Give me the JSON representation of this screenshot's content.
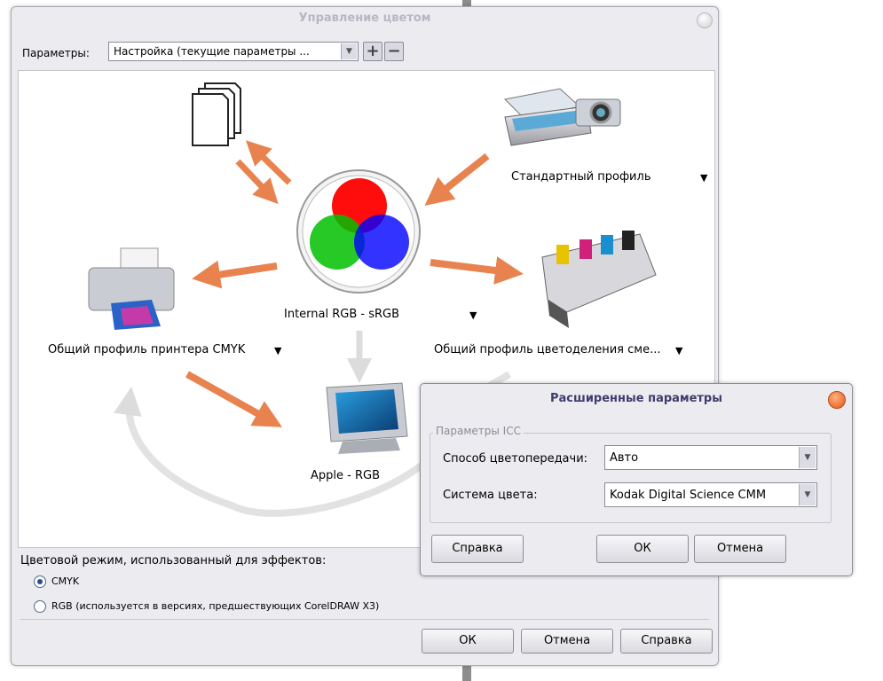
{
  "main_dialog": {
    "title": "Управление цветом",
    "params_label": "Параметры:",
    "preset_value": "Настройка (текущие параметры ...",
    "plus_label": "+",
    "minus_label": "−",
    "nodes": {
      "document_label": "",
      "input_label": "Стандартный профиль",
      "internal_label": "Internal RGB - sRGB",
      "printer_label": "Общий профиль принтера CMYK",
      "separation_label": "Общий профиль цветоделения сме...",
      "monitor_label": "Apple - RGB"
    },
    "dropdown_glyph": "▼",
    "effects_label": "Цветовой режим, использованный для эффектов:",
    "radio_cmyk_label": "CMYK",
    "radio_rgb_label": "RGB (используется в версиях, предшествующих CorelDRAW X3)",
    "radio_selected": "CMYK",
    "ok_label": "ОК",
    "cancel_label": "Отмена",
    "help_label": "Справка"
  },
  "advanced_dialog": {
    "title": "Расширенные параметры",
    "group_title": "Параметры ICC",
    "rendering_label": "Способ цветопередачи:",
    "rendering_value": "Авто",
    "system_label": "Система цвета:",
    "system_value": "Kodak Digital Science CMM",
    "help_label": "Справка",
    "ok_label": "ОК",
    "cancel_label": "Отмена"
  },
  "colors": {
    "arrow": "#e8834f",
    "gray_arrow": "#dcdcdc",
    "close_button": "#e4551c",
    "title_text": "#3c3c6e"
  },
  "icons": [
    "documents-icon",
    "scanner-camera-icon",
    "rgb-circles-icon",
    "printer-icon",
    "press-icon",
    "monitor-icon",
    "close-icon",
    "chevron-down-icon"
  ]
}
